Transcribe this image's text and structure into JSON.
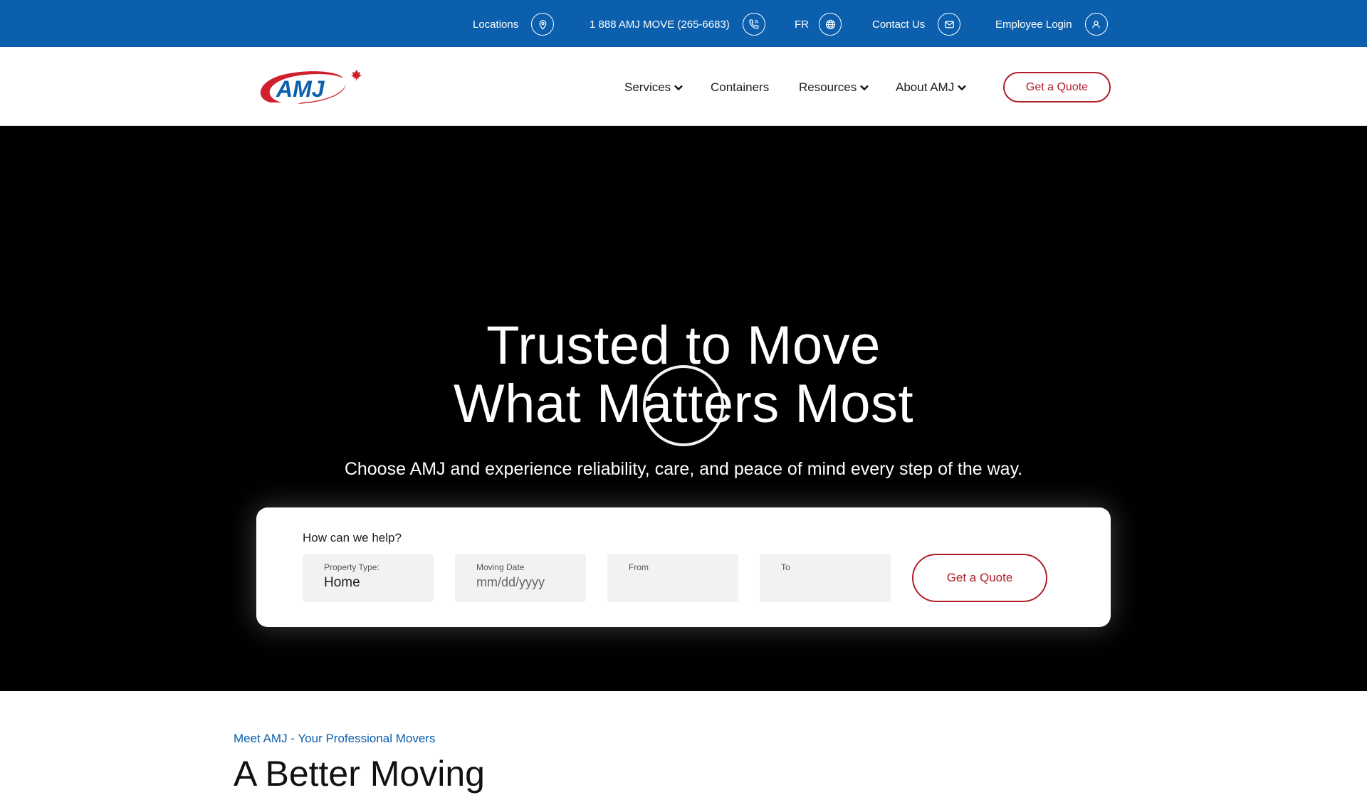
{
  "topbar": {
    "locations": {
      "label": "Locations",
      "icon": "map-pin-icon"
    },
    "phone": {
      "label": "1 888 AMJ MOVE (265-6683)",
      "icon": "phone-icon"
    },
    "language": {
      "label": "FR",
      "icon": "globe-icon"
    },
    "contact": {
      "label": "Contact Us",
      "icon": "mail-icon"
    },
    "employee": {
      "label": "Employee Login",
      "icon": "user-icon"
    },
    "bg_color": "#0c5fad"
  },
  "header": {
    "logo_text": "AMJ",
    "nav": {
      "services": "Services",
      "containers": "Containers",
      "resources": "Resources",
      "about": "About AMJ"
    },
    "quote_button": "Get a Quote"
  },
  "hero": {
    "title_line1": "Trusted to Move",
    "title_line2": "What Matters Most",
    "subtitle": "Choose AMJ and experience reliability, care, and peace of mind every step of the way."
  },
  "quote_form": {
    "heading": "How can we help?",
    "property_type": {
      "label": "Property Type:",
      "value": "Home"
    },
    "moving_date": {
      "label": "Moving Date",
      "placeholder": "mm/dd/yyyy"
    },
    "from": {
      "label": "From",
      "value": ""
    },
    "to": {
      "label": "To",
      "value": ""
    },
    "submit": "Get a Quote"
  },
  "intro": {
    "eyebrow": "Meet AMJ - Your Professional Movers",
    "heading": "A Better Moving"
  },
  "colors": {
    "brand_blue": "#0c5fad",
    "brand_red": "#b01e2a",
    "hero_bg": "#000000"
  }
}
